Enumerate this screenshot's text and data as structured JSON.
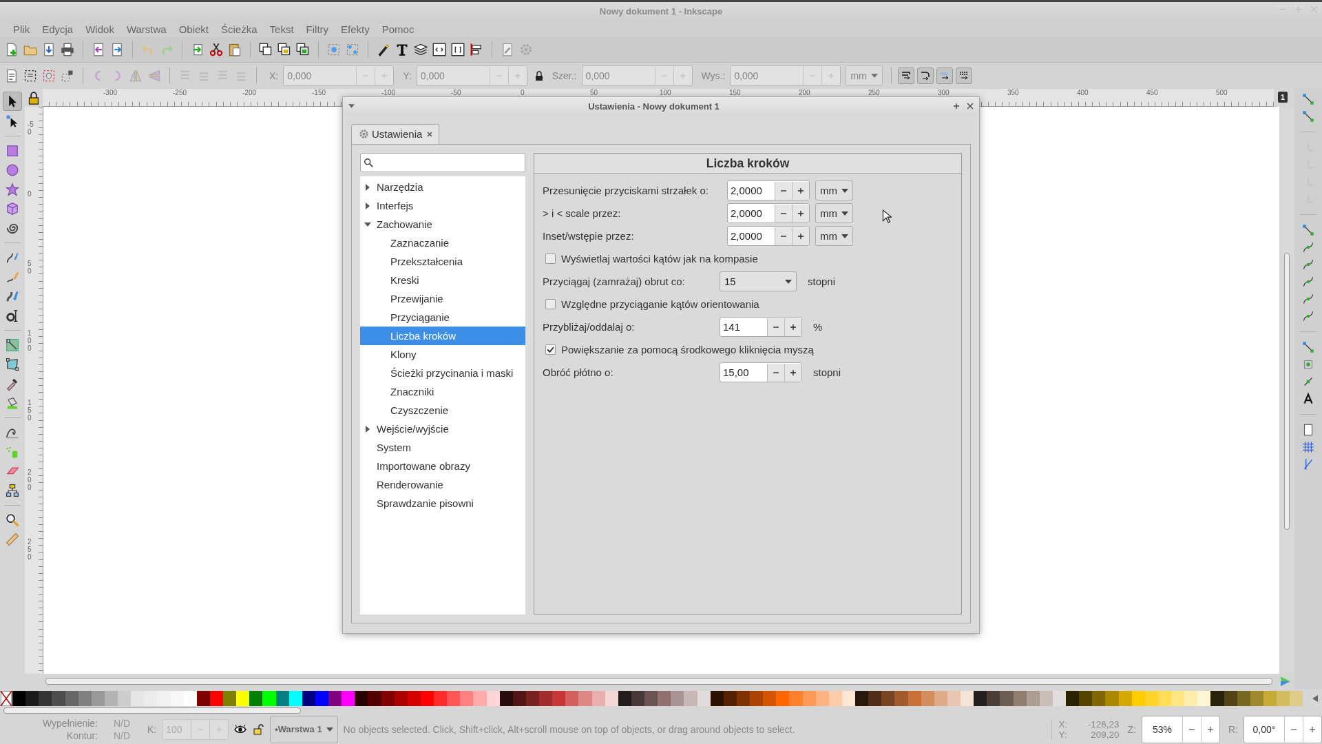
{
  "window": {
    "title": "Nowy dokument 1 - Inkscape"
  },
  "menu": [
    "Plik",
    "Edycja",
    "Widok",
    "Warstwa",
    "Obiekt",
    "Ścieżka",
    "Tekst",
    "Filtry",
    "Efekty",
    "Pomoc"
  ],
  "controls": [
    {
      "label": "X:",
      "value": "0,000",
      "disabled": true
    },
    {
      "label": "Y:",
      "value": "0,000",
      "disabled": true
    },
    {
      "label": "Szer.:",
      "value": "0,000",
      "disabled": true
    },
    {
      "label": "Wys.:",
      "value": "0,000",
      "disabled": true
    }
  ],
  "unit": {
    "value": "mm",
    "disabled": true
  },
  "ruler": {
    "horizontal": [
      "-300",
      "-250",
      "-200",
      "-150",
      "-100",
      "-50",
      "0",
      "50",
      "100",
      "150",
      "200",
      "250",
      "300",
      "350",
      "400",
      "450",
      "500"
    ],
    "vertical": [
      "-50",
      "0",
      "50",
      "100",
      "150",
      "200",
      "250"
    ],
    "page_badge": "1"
  },
  "dialog": {
    "title": "Ustawienia - Nowy dokument 1",
    "tab": "Ustawienia",
    "tree": [
      {
        "label": "Narzędzia",
        "expanded": false,
        "selected": false
      },
      {
        "label": "Interfejs",
        "expanded": false,
        "selected": false
      },
      {
        "label": "Zachowanie",
        "expanded": true,
        "selected": false,
        "children": [
          {
            "label": "Zaznaczanie",
            "selected": false
          },
          {
            "label": "Przekształcenia",
            "selected": false
          },
          {
            "label": "Kreski",
            "selected": false
          },
          {
            "label": "Przewijanie",
            "selected": false
          },
          {
            "label": "Przyciąganie",
            "selected": false
          },
          {
            "label": "Liczba kroków",
            "selected": true
          },
          {
            "label": "Klony",
            "selected": false
          },
          {
            "label": "Ścieżki przycinania i maski",
            "selected": false
          },
          {
            "label": "Znaczniki",
            "selected": false
          },
          {
            "label": "Czyszczenie",
            "selected": false
          }
        ]
      },
      {
        "label": "Wejście/wyjście",
        "expanded": false,
        "selected": false
      },
      {
        "label": "System",
        "selected": false
      },
      {
        "label": "Importowane obrazy",
        "selected": false
      },
      {
        "label": "Renderowanie",
        "selected": false
      },
      {
        "label": "Sprawdzanie pisowni",
        "selected": false
      }
    ],
    "heading": "Liczba kroków",
    "rows": [
      {
        "kind": "spin",
        "label": "Przesunięcie przyciskami strzałek o:",
        "value": "2,0000",
        "unit": "mm"
      },
      {
        "kind": "spin",
        "label": "> i < scale przez:",
        "value": "2,0000",
        "unit": "mm"
      },
      {
        "kind": "spin",
        "label": "Inset/wstępie przez:",
        "value": "2,0000",
        "unit": "mm"
      },
      {
        "kind": "checkbox",
        "label": "Wyświetlaj wartości kątów jak na kompasie",
        "checked": false
      },
      {
        "kind": "combo",
        "label": "Przyciągaj (zamrażaj) obrut co:",
        "value": "15",
        "suffix": "stopni"
      },
      {
        "kind": "checkbox",
        "label": "Względne przyciąganie kątów orientowania",
        "checked": false
      },
      {
        "kind": "spin",
        "label": "Przybliżaj/oddalaj o:",
        "value": "141",
        "suffix": "%"
      },
      {
        "kind": "checkbox",
        "label": "Powiększanie za pomocą środkowego kliknięcia myszą",
        "checked": true
      },
      {
        "kind": "spin",
        "label": "Obróć płótno o:",
        "value": "15,00",
        "suffix": "stopni"
      }
    ]
  },
  "palette": [
    {
      "color": "#000000"
    },
    {
      "color": "#1a1a1a"
    },
    {
      "color": "#333333"
    },
    {
      "color": "#4d4d4d"
    },
    {
      "color": "#666666"
    },
    {
      "color": "#808080"
    },
    {
      "color": "#999999"
    },
    {
      "color": "#b3b3b3"
    },
    {
      "color": "#cccccc"
    },
    {
      "color": "#e6e6e6"
    },
    {
      "color": "#ececec"
    },
    {
      "color": "#f2f2f2"
    },
    {
      "color": "#f8f8f8"
    },
    {
      "color": "#ffffff"
    },
    {
      "color": "#800000"
    },
    {
      "color": "#ff0000"
    },
    {
      "color": "#808000"
    },
    {
      "color": "#ffff00"
    },
    {
      "color": "#008000"
    },
    {
      "color": "#00ff00"
    },
    {
      "color": "#008080"
    },
    {
      "color": "#00ffff"
    },
    {
      "color": "#000080"
    },
    {
      "color": "#0000ff"
    },
    {
      "color": "#800080"
    },
    {
      "color": "#ff00ff"
    },
    {
      "color": "#2b0000"
    },
    {
      "color": "#550000"
    },
    {
      "color": "#800001"
    },
    {
      "color": "#aa0000"
    },
    {
      "color": "#d40000"
    },
    {
      "color": "#ff0001"
    },
    {
      "color": "#ff2a2a"
    },
    {
      "color": "#ff5555"
    },
    {
      "color": "#ff8080"
    },
    {
      "color": "#ffaaaa"
    },
    {
      "color": "#ffd5d5"
    },
    {
      "color": "#280b0b"
    },
    {
      "color": "#501616"
    },
    {
      "color": "#782121"
    },
    {
      "color": "#a02c2c"
    },
    {
      "color": "#c83737"
    },
    {
      "color": "#d35f5f"
    },
    {
      "color": "#de8787"
    },
    {
      "color": "#e9afaf"
    },
    {
      "color": "#f4d7d7"
    },
    {
      "color": "#241c1c"
    },
    {
      "color": "#483737"
    },
    {
      "color": "#6c5353"
    },
    {
      "color": "#916f6f"
    },
    {
      "color": "#ac9393"
    },
    {
      "color": "#c8b7b7"
    },
    {
      "color": "#e3dbdb"
    },
    {
      "color": "#2b1100"
    },
    {
      "color": "#552200"
    },
    {
      "color": "#803300"
    },
    {
      "color": "#aa4400"
    },
    {
      "color": "#d45500"
    },
    {
      "color": "#ff6600"
    },
    {
      "color": "#ff7f2a"
    },
    {
      "color": "#ff9955"
    },
    {
      "color": "#ffb380"
    },
    {
      "color": "#ffccaa"
    },
    {
      "color": "#ffe6d5"
    },
    {
      "color": "#28170b"
    },
    {
      "color": "#502d16"
    },
    {
      "color": "#784421"
    },
    {
      "color": "#a05a2c"
    },
    {
      "color": "#c87137"
    },
    {
      "color": "#d38d5f"
    },
    {
      "color": "#deaa87"
    },
    {
      "color": "#e9c6af"
    },
    {
      "color": "#f4e3d7"
    },
    {
      "color": "#241f1c"
    },
    {
      "color": "#483e37"
    },
    {
      "color": "#6c5d53"
    },
    {
      "color": "#917c6f"
    },
    {
      "color": "#ac9d93"
    },
    {
      "color": "#c8beb7"
    },
    {
      "color": "#e3dedb"
    },
    {
      "color": "#2b2200"
    },
    {
      "color": "#554400"
    },
    {
      "color": "#806600"
    },
    {
      "color": "#aa8800"
    },
    {
      "color": "#d4aa00"
    },
    {
      "color": "#ffcc00"
    },
    {
      "color": "#ffd42a"
    },
    {
      "color": "#ffdd55"
    },
    {
      "color": "#ffe680"
    },
    {
      "color": "#ffeeaa"
    },
    {
      "color": "#fff6d5"
    },
    {
      "color": "#28220b"
    },
    {
      "color": "#504416"
    },
    {
      "color": "#786721"
    },
    {
      "color": "#a0892c"
    },
    {
      "color": "#c8ab37"
    },
    {
      "color": "#d3bc5f"
    },
    {
      "color": "#decd87"
    }
  ],
  "status_bar": {
    "fill_label": "Wypełnienie:",
    "fill_value": "N/D",
    "stroke_label": "Kontur:",
    "stroke_value": "N/D",
    "opacity_label": "K:",
    "opacity_value": "100",
    "opacity_disabled": true,
    "layer": "•Warstwa 1",
    "message": "No objects selected. Click, Shift+click, Alt+scroll mouse on top of objects, or drag around objects to select.",
    "x_label": "X:",
    "x_value": "-126,23",
    "y_label": "Y:",
    "y_value": "209,20",
    "zoom_label": "Z:",
    "zoom_value": "53%",
    "rotate_label": "R:",
    "rotate_value": "0,00°"
  }
}
